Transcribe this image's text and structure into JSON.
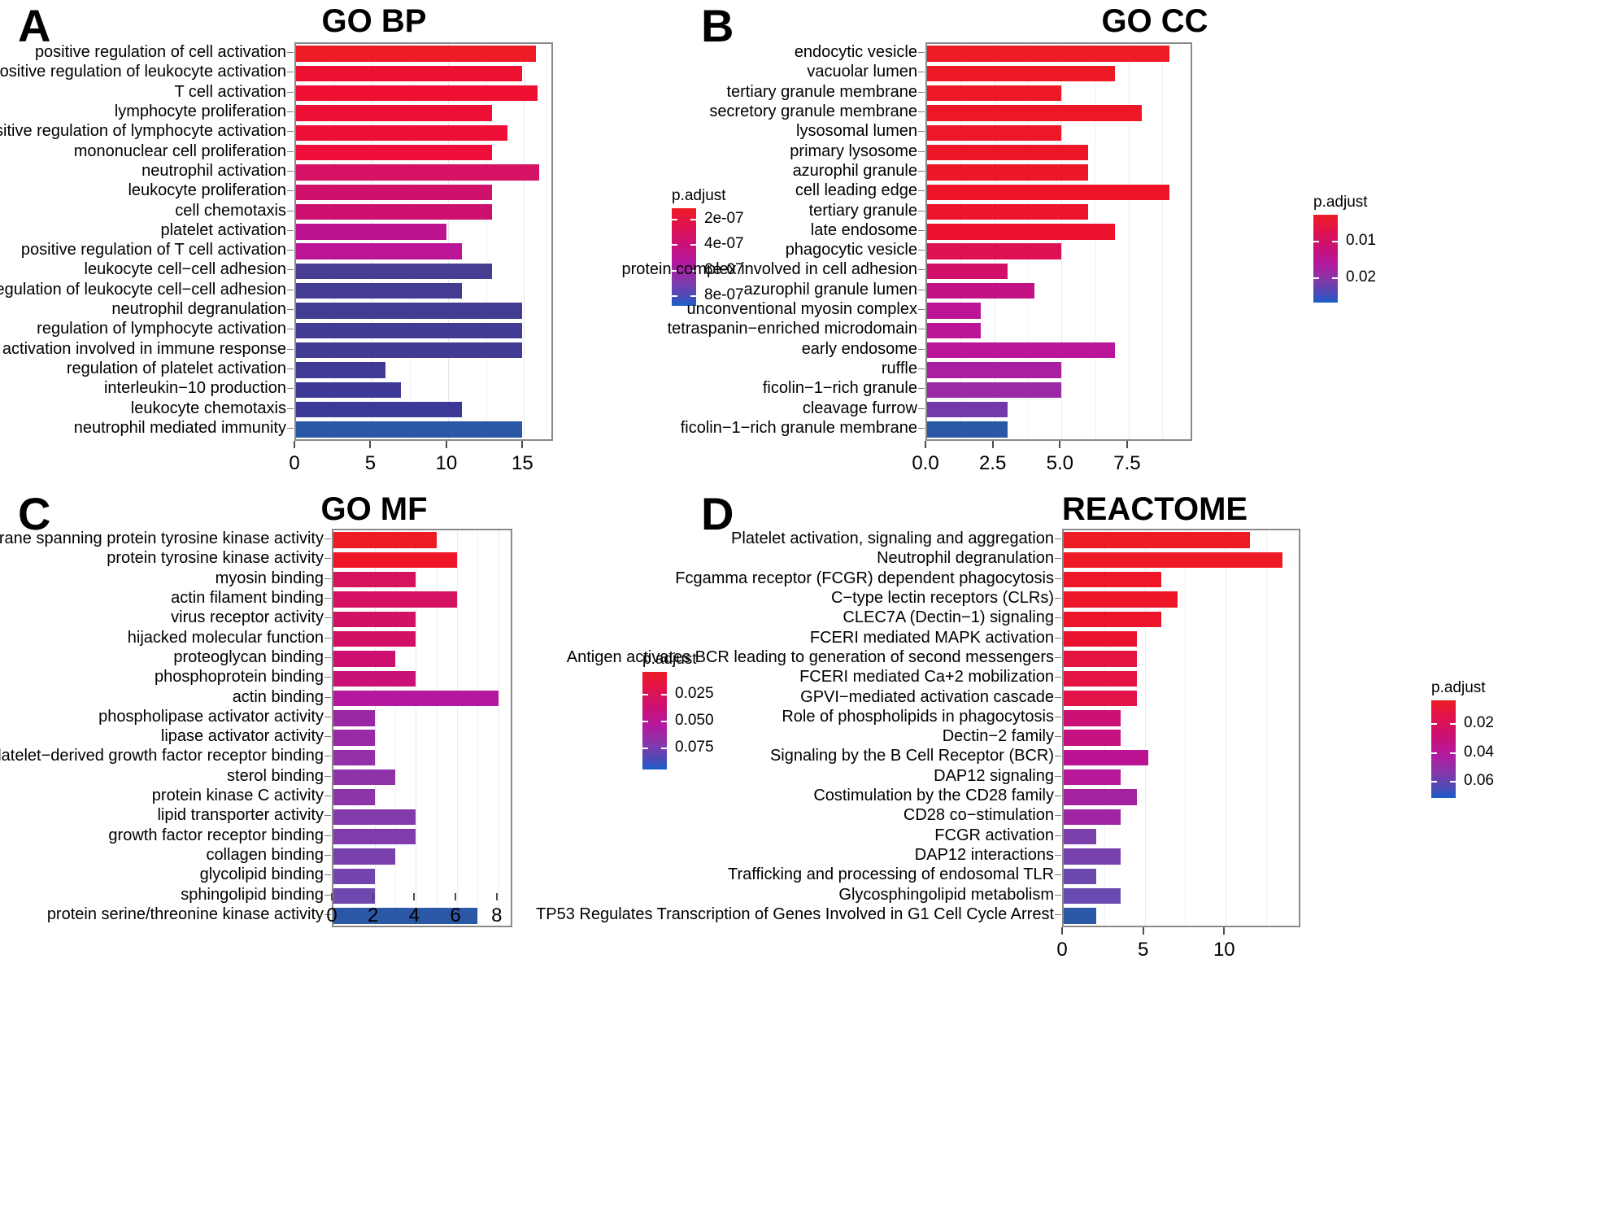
{
  "figure": {
    "panels": [
      {
        "letter": "A",
        "title": "GO BP",
        "legend_title": "p.adjust",
        "legend_labels": [
          "2e-07",
          "4e-07",
          "6e-07",
          "8e-07"
        ],
        "axis_ticks": [
          "0",
          "5",
          "10",
          "15"
        ],
        "chart_data": {
          "type": "bar",
          "title": "GO BP",
          "xlabel": "",
          "ylabel": "",
          "xlim": [
            0,
            16.8
          ],
          "grid": true,
          "legend_position": "right",
          "colorbar": {
            "label": "p.adjust",
            "ticks": [
              2e-07,
              4e-07,
              6e-07,
              8e-07
            ],
            "range": [
              1.2e-07,
              8.8e-07
            ]
          },
          "categories": [
            "positive regulation of cell activation",
            "positive regulation of leukocyte activation",
            "T cell activation",
            "lymphocyte proliferation",
            "positive regulation of lymphocyte activation",
            "mononuclear cell proliferation",
            "neutrophil activation",
            "leukocyte proliferation",
            "cell chemotaxis",
            "platelet activation",
            "positive regulation of T cell activation",
            "leukocyte cell−cell adhesion",
            "positive regulation of leukocyte cell−cell adhesion",
            "neutrophil degranulation",
            "regulation of lymphocyte activation",
            "neutrophil activation involved in immune response",
            "regulation of platelet activation",
            "interleukin−10 production",
            "leukocyte chemotaxis",
            "neutrophil mediated immunity"
          ],
          "values": [
            15.8,
            14.9,
            15.9,
            12.9,
            13.9,
            12.9,
            16.0,
            12.9,
            12.9,
            9.9,
            10.9,
            12.9,
            10.9,
            14.9,
            14.9,
            14.9,
            5.9,
            6.9,
            10.9,
            14.9
          ],
          "padjust": [
            1.5e-07,
            1.7e-07,
            1.9e-07,
            2e-07,
            2.1e-07,
            2.2e-07,
            2.9e-07,
            3.3e-07,
            3.6e-07,
            4.6e-07,
            4.9e-07,
            7.2e-07,
            7.4e-07,
            7.6e-07,
            7.7e-07,
            7.8e-07,
            8e-07,
            8.1e-07,
            8.3e-07,
            8.7e-07
          ],
          "colors": [
            "#ED1C24",
            "#EE1030",
            "#EE0F33",
            "#EE0F35",
            "#EE0F37",
            "#EE0E39",
            "#D51263",
            "#D0116B",
            "#CD1070",
            "#BE1390",
            "#BB1496",
            "#473E92",
            "#443C93",
            "#433C93",
            "#423B93",
            "#413B94",
            "#403A95",
            "#3E3996",
            "#3C3897",
            "#2B58A6"
          ]
        }
      },
      {
        "letter": "B",
        "title": "GO CC",
        "legend_title": "p.adjust",
        "legend_labels": [
          "0.01",
          "0.02"
        ],
        "axis_ticks": [
          "0.0",
          "2.5",
          "5.0",
          "7.5"
        ],
        "chart_data": {
          "type": "bar",
          "title": "GO CC",
          "xlabel": "",
          "ylabel": "",
          "xlim": [
            0,
            9.8
          ],
          "grid": true,
          "legend_position": "right",
          "colorbar": {
            "label": "p.adjust",
            "ticks": [
              0.01,
              0.02
            ],
            "range": [
              0.003,
              0.027
            ]
          },
          "categories": [
            "endocytic vesicle",
            "vacuolar lumen",
            "tertiary granule membrane",
            "secretory granule membrane",
            "lysosomal lumen",
            "primary lysosome",
            "azurophil granule",
            "cell leading edge",
            "tertiary granule",
            "late endosome",
            "phagocytic vesicle",
            "protein complex involved in cell adhesion",
            "azurophil granule lumen",
            "unconventional myosin complex",
            "tetraspanin−enriched microdomain",
            "early endosome",
            "ruffle",
            "ficolin−1−rich granule",
            "cleavage furrow",
            "ficolin−1−rich granule membrane"
          ],
          "values": [
            9.0,
            7.0,
            5.0,
            8.0,
            5.0,
            6.0,
            6.0,
            9.0,
            6.0,
            7.0,
            5.0,
            3.0,
            4.0,
            2.0,
            2.0,
            7.0,
            5.0,
            5.0,
            3.0,
            3.0
          ],
          "padjust": [
            0.003,
            0.004,
            0.004,
            0.004,
            0.005,
            0.005,
            0.005,
            0.005,
            0.006,
            0.006,
            0.008,
            0.01,
            0.012,
            0.014,
            0.014,
            0.015,
            0.017,
            0.018,
            0.021,
            0.026
          ],
          "colors": [
            "#ED1C24",
            "#ED1A25",
            "#ED1926",
            "#ED1826",
            "#ED1727",
            "#ED1628",
            "#ED1529",
            "#ED142A",
            "#EC132C",
            "#EC122E",
            "#DE1252",
            "#D11169",
            "#C21285",
            "#BB1496",
            "#BA1497",
            "#B91599",
            "#A8209F",
            "#9B28A4",
            "#7338AB",
            "#2B58A6"
          ]
        }
      },
      {
        "letter": "C",
        "title": "GO MF",
        "legend_title": "p.adjust",
        "legend_labels": [
          "0.025",
          "0.050",
          "0.075"
        ],
        "axis_ticks": [
          "0",
          "2",
          "4",
          "6",
          "8"
        ],
        "chart_data": {
          "type": "bar",
          "title": "GO MF",
          "xlabel": "",
          "ylabel": "",
          "xlim": [
            0,
            8.6
          ],
          "grid": true,
          "legend_position": "right",
          "colorbar": {
            "label": "p.adjust",
            "ticks": [
              0.025,
              0.05,
              0.075
            ],
            "range": [
              0.005,
              0.095
            ]
          },
          "categories": [
            "non−membrane spanning protein tyrosine kinase activity",
            "protein tyrosine kinase activity",
            "myosin binding",
            "actin filament binding",
            "virus receptor activity",
            "hijacked molecular function",
            "proteoglycan binding",
            "phosphoprotein binding",
            "actin binding",
            "phospholipase activator activity",
            "lipase activator activity",
            "platelet−derived growth factor receptor binding",
            "sterol binding",
            "protein kinase C activity",
            "lipid transporter activity",
            "growth factor receptor binding",
            "collagen binding",
            "glycolipid binding",
            "sphingolipid binding",
            "protein serine/threonine kinase activity"
          ],
          "values": [
            5.0,
            6.0,
            4.0,
            6.0,
            4.0,
            4.0,
            3.0,
            4.0,
            8.0,
            2.0,
            2.0,
            2.0,
            3.0,
            2.0,
            4.0,
            4.0,
            3.0,
            2.0,
            2.0,
            7.0
          ],
          "padjust": [
            0.006,
            0.008,
            0.017,
            0.018,
            0.019,
            0.019,
            0.022,
            0.024,
            0.038,
            0.05,
            0.052,
            0.056,
            0.058,
            0.06,
            0.065,
            0.066,
            0.07,
            0.074,
            0.078,
            0.092
          ],
          "colors": [
            "#ED1C24",
            "#ED1527",
            "#D6125D",
            "#D41162",
            "#D21166",
            "#D21166",
            "#CD1070",
            "#CA1177",
            "#B4189E",
            "#9C27A4",
            "#9929A5",
            "#9330A7",
            "#8F33A8",
            "#8C35A9",
            "#833BAB",
            "#813CAC",
            "#7A41AD",
            "#7444AE",
            "#6E48AF",
            "#2B58A6"
          ]
        }
      },
      {
        "letter": "D",
        "title": "REACTOME",
        "legend_title": "p.adjust",
        "legend_labels": [
          "0.02",
          "0.04",
          "0.06"
        ],
        "axis_ticks": [
          "0",
          "5",
          "10"
        ],
        "chart_data": {
          "type": "bar",
          "title": "REACTOME",
          "xlabel": "",
          "ylabel": "",
          "xlim": [
            0,
            14.5
          ],
          "grid": true,
          "legend_position": "right",
          "colorbar": {
            "label": "p.adjust",
            "ticks": [
              0.02,
              0.04,
              0.06
            ],
            "range": [
              0.004,
              0.072
            ]
          },
          "categories": [
            "Platelet activation, signaling and aggregation",
            "Neutrophil degranulation",
            "Fcgamma receptor (FCGR) dependent phagocytosis",
            "C−type lectin receptors (CLRs)",
            "CLEC7A (Dectin−1) signaling",
            "FCERI mediated MAPK activation",
            "Antigen activates BCR leading to generation of second messengers",
            "FCERI mediated Ca+2 mobilization",
            "GPVI−mediated activation cascade",
            "Role of phospholipids in phagocytosis",
            "Dectin−2 family",
            "Signaling by the B Cell Receptor (BCR)",
            "DAP12 signaling",
            "Costimulation by the CD28 family",
            "CD28 co−stimulation",
            "FCGR activation",
            "DAP12 interactions",
            "Trafficking and processing of endosomal TLR",
            "Glycosphingolipid metabolism",
            "TP53 Regulates Transcription of Genes Involved in G1 Cell Cycle Arrest"
          ],
          "values": [
            11.5,
            13.5,
            6.0,
            7.0,
            6.0,
            4.5,
            4.5,
            4.5,
            4.5,
            3.5,
            3.5,
            5.2,
            3.5,
            4.5,
            3.5,
            2.0,
            3.5,
            2.0,
            3.5,
            2.0
          ],
          "padjust": [
            0.004,
            0.004,
            0.006,
            0.007,
            0.008,
            0.01,
            0.011,
            0.011,
            0.012,
            0.022,
            0.024,
            0.028,
            0.03,
            0.036,
            0.038,
            0.052,
            0.054,
            0.062,
            0.064,
            0.07
          ],
          "colors": [
            "#ED1C24",
            "#ED1A25",
            "#ED1727",
            "#ED1528",
            "#EC142A",
            "#EA132F",
            "#E51340",
            "#E41342",
            "#E11349",
            "#CB1175",
            "#C61280",
            "#BC1394",
            "#B71799",
            "#A4229F",
            "#9F25A2",
            "#7B40AC",
            "#7742AD",
            "#6B4AAF",
            "#684BB0",
            "#2B58A6"
          ]
        }
      }
    ]
  }
}
